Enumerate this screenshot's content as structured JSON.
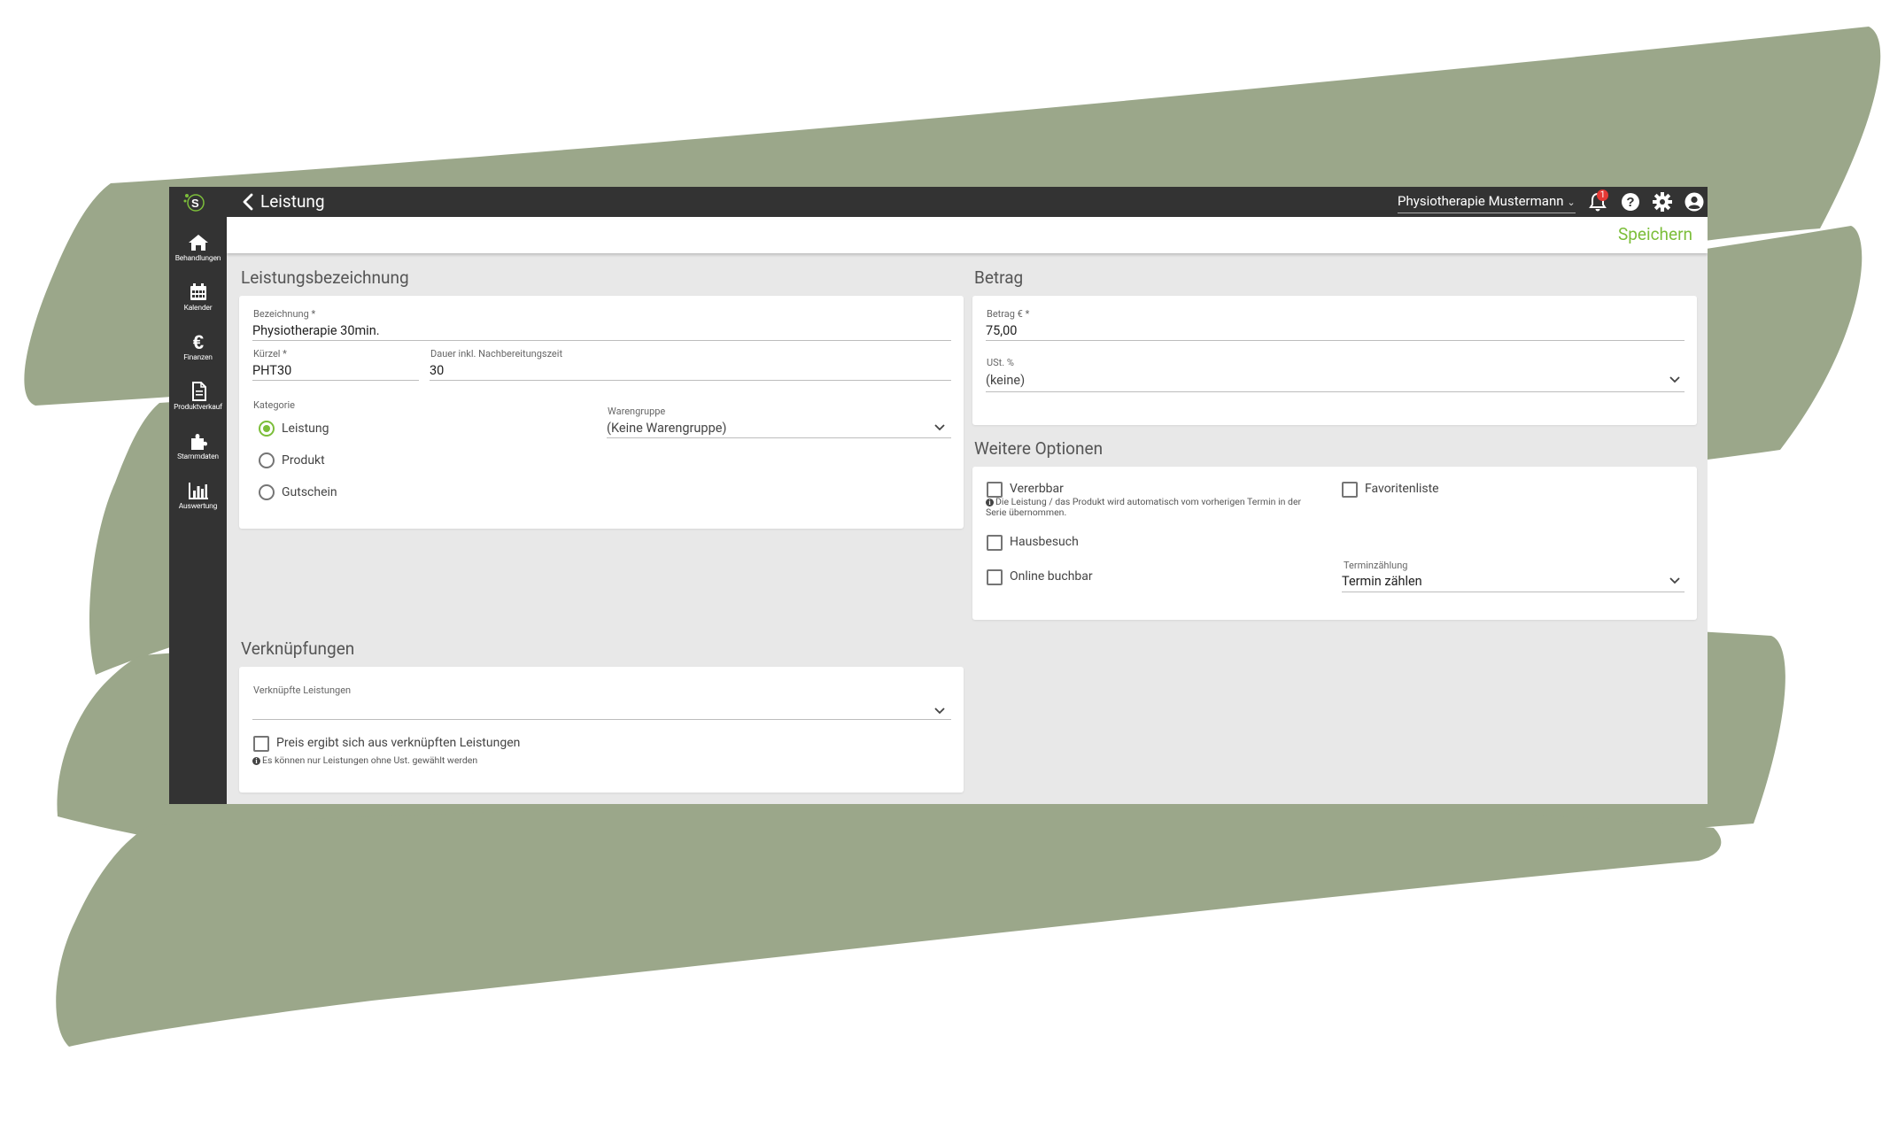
{
  "colors": {
    "accent_green": "#7cbe3a",
    "dark_bar": "#333333",
    "content_bg": "#e8e8e8",
    "brush_green": "#9ba78a",
    "badge_red": "#e53935"
  },
  "header": {
    "title": "Leistung",
    "practice_name": "Physiotherapie Mustermann",
    "notification_count": "1",
    "icons": [
      "back-icon",
      "bell-icon",
      "help-icon",
      "gear-icon",
      "user-icon"
    ]
  },
  "sidebar": {
    "items": [
      {
        "label": "Behandlungen",
        "icon": "home-icon"
      },
      {
        "label": "Kalender",
        "icon": "calendar-icon"
      },
      {
        "label": "Finanzen",
        "icon": "euro-icon"
      },
      {
        "label": "Produktverkauf",
        "icon": "document-icon"
      },
      {
        "label": "Stammdaten",
        "icon": "puzzle-icon"
      },
      {
        "label": "Auswertung",
        "icon": "chart-icon"
      }
    ]
  },
  "toolbar": {
    "save_label": "Speichern"
  },
  "leistungsbezeichnung": {
    "title": "Leistungsbezeichnung",
    "bezeichnung_label": "Bezeichnung *",
    "bezeichnung_value": "Physiotherapie 30min.",
    "kuerzel_label": "Kürzel *",
    "kuerzel_value": "PHT30",
    "dauer_label": "Dauer inkl. Nachbereitungszeit",
    "dauer_value": "30",
    "kategorie_label": "Kategorie",
    "kategorie_options": [
      "Leistung",
      "Produkt",
      "Gutschein"
    ],
    "kategorie_selected": "Leistung",
    "warengruppe_label": "Warengruppe",
    "warengruppe_value": "(Keine Warengruppe)"
  },
  "betrag": {
    "title": "Betrag",
    "betrag_label": "Betrag € *",
    "betrag_value": "75,00",
    "ust_label": "USt. %",
    "ust_value": "(keine)"
  },
  "weitere_optionen": {
    "title": "Weitere Optionen",
    "vererbbar_label": "Vererbbar",
    "vererbbar_hint": "Die Leistung / das Produkt wird automatisch vom vorherigen Termin in der Serie übernommen.",
    "favoritenliste_label": "Favoritenliste",
    "hausbesuch_label": "Hausbesuch",
    "online_buchbar_label": "Online buchbar",
    "terminzaehlung_label": "Terminzählung",
    "terminzaehlung_value": "Termin zählen"
  },
  "verknuepfungen": {
    "title": "Verknüpfungen",
    "leistungen_label": "Verknüpfte Leistungen",
    "leistungen_value": "",
    "preis_label": "Preis ergibt sich aus verknüpften Leistungen",
    "preis_hint": "Es können nur Leistungen ohne Ust. gewählt werden"
  }
}
